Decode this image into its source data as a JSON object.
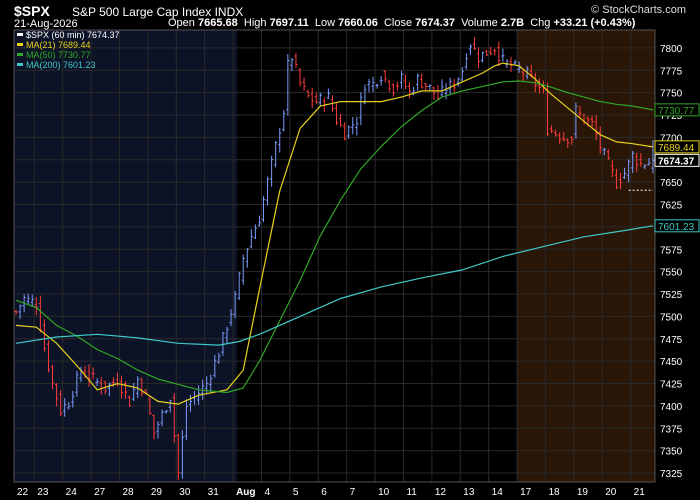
{
  "header": {
    "symbol": "$SPX",
    "name": "S&P 500 Large Cap Index",
    "exchange": "INDX",
    "credit": "© StockCharts.com",
    "date": "21-Aug-2026",
    "open_label": "Open",
    "open": "7665.68",
    "high_label": "High",
    "high": "7697.11",
    "low_label": "Low",
    "low": "7660.06",
    "close_label": "Close",
    "close": "7674.37",
    "volume_label": "Volume",
    "volume": "2.7B",
    "chg_label": "Chg",
    "chg": "+33.21 (+0.43%)"
  },
  "legend": [
    {
      "text": "$SPX (60 min) 7674.37",
      "color": "#ffffff"
    },
    {
      "text": "MA(21) 7689.44",
      "color": "#e8d21d"
    },
    {
      "text": "MA(50) 7730.77",
      "color": "#2fa826"
    },
    {
      "text": "MA(200) 7601.23",
      "color": "#3ec9c9"
    }
  ],
  "last_labels": [
    {
      "text": "7730.77",
      "value": 7730.77,
      "color": "#2fa826"
    },
    {
      "text": "7689.44",
      "value": 7689.44,
      "color": "#e8d21d"
    },
    {
      "text": "7674.37",
      "value": 7674.37,
      "color": "#ffffff"
    },
    {
      "text": "7601.23",
      "value": 7601.23,
      "color": "#3ec9c9"
    }
  ],
  "chart_data": {
    "type": "line",
    "chart_kind": "ohlc-bars",
    "interval": "60 min",
    "ylim": [
      7315,
      7820
    ],
    "y_ticks": [
      7325,
      7350,
      7375,
      7400,
      7425,
      7450,
      7475,
      7500,
      7525,
      7550,
      7575,
      7600,
      7625,
      7650,
      7675,
      7700,
      7725,
      7750,
      7775,
      7800
    ],
    "x_tick_labels": [
      "22",
      "23",
      "24",
      "27",
      "28",
      "29",
      "30",
      "31",
      "Aug",
      "4",
      "5",
      "6",
      "7",
      "10",
      "11",
      "12",
      "13",
      "14",
      "17",
      "18",
      "19",
      "20",
      "21"
    ],
    "x_tick_bar_index": [
      0,
      5,
      12,
      19,
      26,
      33,
      40,
      47,
      54,
      61,
      68,
      75,
      82,
      89,
      96,
      103,
      110,
      117,
      124,
      131,
      138,
      145,
      152
    ],
    "grid": true,
    "shaded_regions": [
      {
        "from_bar": 0,
        "to_bar": 54,
        "color": "#0c1326"
      },
      {
        "from_bar": 124,
        "to_bar": 157,
        "color": "#2a1606"
      }
    ],
    "reference_line": {
      "value": 7641,
      "from_bar": 151,
      "to_bar": 157
    },
    "price_keypoints": [
      [
        0,
        7505
      ],
      [
        2,
        7520
      ],
      [
        5,
        7515
      ],
      [
        7,
        7465
      ],
      [
        9,
        7425
      ],
      [
        11,
        7395
      ],
      [
        13,
        7405
      ],
      [
        16,
        7440
      ],
      [
        19,
        7430
      ],
      [
        22,
        7420
      ],
      [
        25,
        7430
      ],
      [
        28,
        7405
      ],
      [
        30,
        7430
      ],
      [
        32,
        7410
      ],
      [
        34,
        7370
      ],
      [
        36,
        7390
      ],
      [
        38,
        7410
      ],
      [
        40,
        7325
      ],
      [
        42,
        7400
      ],
      [
        45,
        7415
      ],
      [
        47,
        7425
      ],
      [
        50,
        7460
      ],
      [
        52,
        7490
      ],
      [
        54,
        7520
      ],
      [
        56,
        7565
      ],
      [
        58,
        7590
      ],
      [
        60,
        7610
      ],
      [
        62,
        7650
      ],
      [
        64,
        7690
      ],
      [
        66,
        7730
      ],
      [
        67,
        7780
      ],
      [
        68,
        7790
      ],
      [
        70,
        7760
      ],
      [
        72,
        7745
      ],
      [
        74,
        7740
      ],
      [
        77,
        7745
      ],
      [
        79,
        7720
      ],
      [
        81,
        7705
      ],
      [
        84,
        7720
      ],
      [
        86,
        7760
      ],
      [
        88,
        7760
      ],
      [
        90,
        7770
      ],
      [
        93,
        7755
      ],
      [
        95,
        7765
      ],
      [
        97,
        7750
      ],
      [
        99,
        7765
      ],
      [
        102,
        7755
      ],
      [
        104,
        7745
      ],
      [
        106,
        7755
      ],
      [
        108,
        7760
      ],
      [
        110,
        7775
      ],
      [
        111,
        7795
      ],
      [
        112,
        7805
      ],
      [
        114,
        7790
      ],
      [
        116,
        7795
      ],
      [
        118,
        7800
      ],
      [
        120,
        7785
      ],
      [
        122,
        7780
      ],
      [
        124,
        7775
      ],
      [
        126,
        7770
      ],
      [
        128,
        7760
      ],
      [
        130,
        7750
      ],
      [
        131,
        7710
      ],
      [
        133,
        7705
      ],
      [
        135,
        7700
      ],
      [
        137,
        7700
      ],
      [
        138,
        7730
      ],
      [
        140,
        7720
      ],
      [
        142,
        7715
      ],
      [
        144,
        7690
      ],
      [
        146,
        7670
      ],
      [
        148,
        7650
      ],
      [
        150,
        7660
      ],
      [
        152,
        7680
      ],
      [
        154,
        7670
      ],
      [
        157,
        7674
      ]
    ],
    "series": [
      {
        "name": "$SPX (60 min)",
        "color": "#ffffff",
        "last": 7674.37
      },
      {
        "name": "MA(21)",
        "color": "#e8d21d",
        "last": 7689.44,
        "points": [
          [
            0,
            7490
          ],
          [
            5,
            7488
          ],
          [
            10,
            7470
          ],
          [
            15,
            7445
          ],
          [
            20,
            7418
          ],
          [
            25,
            7425
          ],
          [
            30,
            7420
          ],
          [
            35,
            7405
          ],
          [
            40,
            7402
          ],
          [
            45,
            7412
          ],
          [
            52,
            7418
          ],
          [
            56,
            7440
          ],
          [
            60,
            7530
          ],
          [
            65,
            7640
          ],
          [
            70,
            7710
          ],
          [
            75,
            7735
          ],
          [
            80,
            7740
          ],
          [
            85,
            7740
          ],
          [
            90,
            7740
          ],
          [
            95,
            7745
          ],
          [
            100,
            7752
          ],
          [
            105,
            7752
          ],
          [
            110,
            7762
          ],
          [
            115,
            7772
          ],
          [
            118,
            7780
          ],
          [
            120,
            7783
          ],
          [
            124,
            7780
          ],
          [
            128,
            7765
          ],
          [
            132,
            7748
          ],
          [
            136,
            7733
          ],
          [
            140,
            7718
          ],
          [
            144,
            7703
          ],
          [
            148,
            7695
          ],
          [
            152,
            7693
          ],
          [
            157,
            7689.44
          ]
        ]
      },
      {
        "name": "MA(50)",
        "color": "#2fa826",
        "last": 7730.77,
        "points": [
          [
            0,
            7518
          ],
          [
            5,
            7510
          ],
          [
            10,
            7490
          ],
          [
            15,
            7478
          ],
          [
            20,
            7463
          ],
          [
            25,
            7453
          ],
          [
            30,
            7440
          ],
          [
            35,
            7430
          ],
          [
            40,
            7424
          ],
          [
            45,
            7418
          ],
          [
            52,
            7415
          ],
          [
            56,
            7420
          ],
          [
            60,
            7450
          ],
          [
            65,
            7495
          ],
          [
            70,
            7540
          ],
          [
            75,
            7590
          ],
          [
            80,
            7630
          ],
          [
            85,
            7665
          ],
          [
            90,
            7690
          ],
          [
            95,
            7712
          ],
          [
            100,
            7730
          ],
          [
            105,
            7745
          ],
          [
            110,
            7752
          ],
          [
            115,
            7757
          ],
          [
            120,
            7762
          ],
          [
            124,
            7763
          ],
          [
            128,
            7761
          ],
          [
            132,
            7756
          ],
          [
            136,
            7750
          ],
          [
            140,
            7745
          ],
          [
            144,
            7740
          ],
          [
            148,
            7737
          ],
          [
            152,
            7735
          ],
          [
            157,
            7730.77
          ]
        ]
      },
      {
        "name": "MA(200)",
        "color": "#3ec9c9",
        "last": 7601.23,
        "points": [
          [
            0,
            7470
          ],
          [
            10,
            7477
          ],
          [
            20,
            7480
          ],
          [
            30,
            7476
          ],
          [
            40,
            7470
          ],
          [
            50,
            7468
          ],
          [
            55,
            7472
          ],
          [
            60,
            7480
          ],
          [
            70,
            7500
          ],
          [
            80,
            7520
          ],
          [
            90,
            7533
          ],
          [
            100,
            7543
          ],
          [
            110,
            7552
          ],
          [
            120,
            7567
          ],
          [
            130,
            7578
          ],
          [
            140,
            7589
          ],
          [
            150,
            7596
          ],
          [
            157,
            7601.23
          ]
        ]
      }
    ]
  }
}
